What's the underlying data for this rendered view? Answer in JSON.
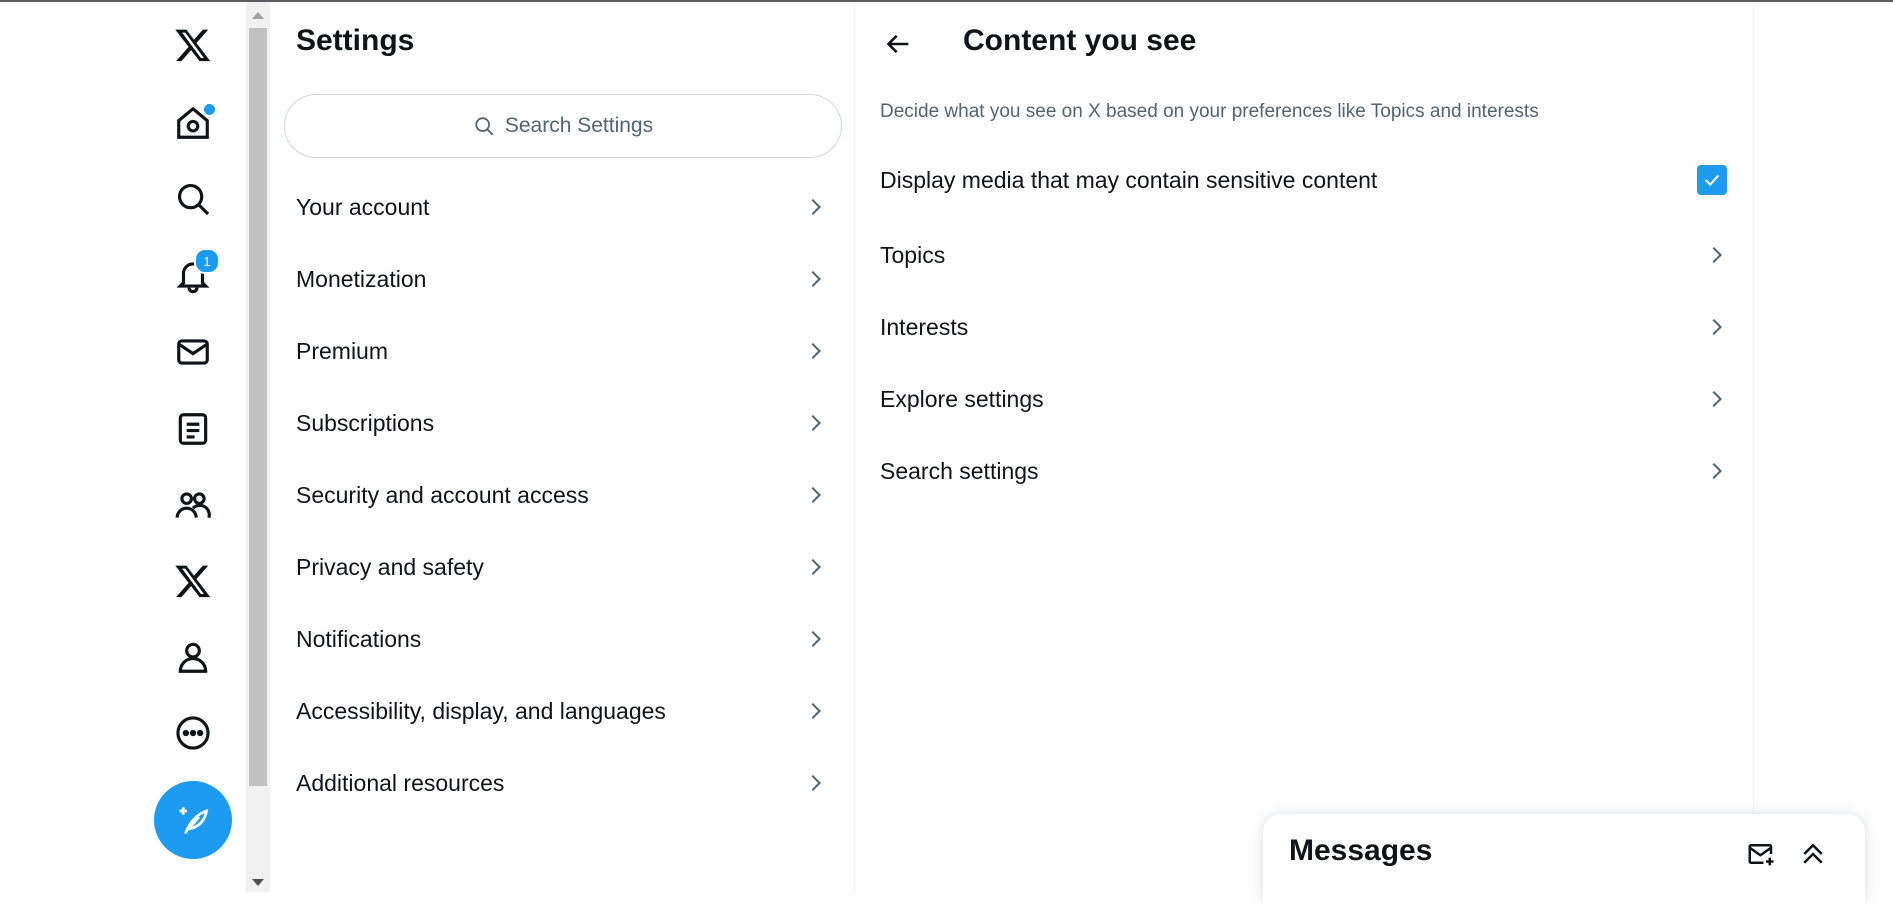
{
  "nav": {
    "icons": [
      "x-logo-icon",
      "home-icon",
      "explore-icon",
      "notifications-icon",
      "messages-icon",
      "lists-icon",
      "communities-icon",
      "premium-icon",
      "profile-icon",
      "more-icon"
    ],
    "notification_count": "1",
    "compose_icon": "compose-post-icon"
  },
  "settings": {
    "title": "Settings",
    "search_placeholder": "Search Settings",
    "items": [
      {
        "label": "Your account"
      },
      {
        "label": "Monetization"
      },
      {
        "label": "Premium"
      },
      {
        "label": "Subscriptions"
      },
      {
        "label": "Security and account access"
      },
      {
        "label": "Privacy and safety"
      },
      {
        "label": "Notifications"
      },
      {
        "label": "Accessibility, display, and languages"
      },
      {
        "label": "Additional resources"
      }
    ]
  },
  "content": {
    "title": "Content you see",
    "description": "Decide what you see on X based on your preferences like Topics and interests",
    "sensitive_label": "Display media that may contain sensitive content",
    "sensitive_checked": true,
    "rows": [
      {
        "label": "Topics"
      },
      {
        "label": "Interests"
      },
      {
        "label": "Explore settings"
      },
      {
        "label": "Search settings"
      }
    ]
  },
  "messages": {
    "title": "Messages"
  },
  "colors": {
    "accent": "#1d9bf0",
    "text": "#0f1419",
    "muted": "#536471"
  }
}
